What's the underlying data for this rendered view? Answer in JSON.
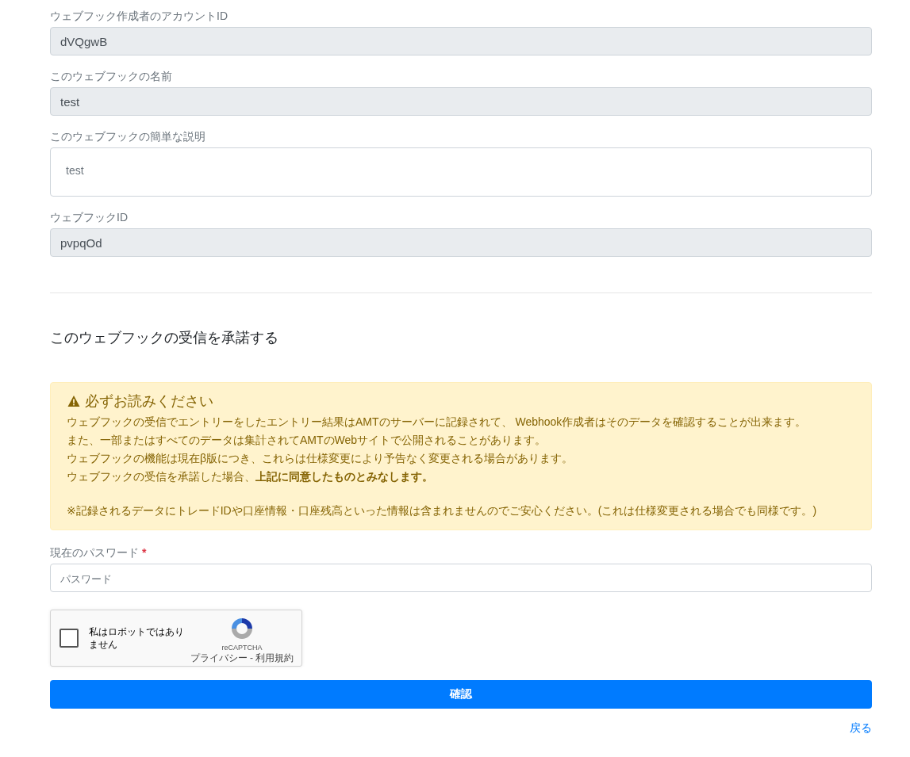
{
  "fields": [
    {
      "label": "ウェブフック作成者のアカウントID",
      "value": "dVQgwB",
      "kind": "input",
      "disabled": true
    },
    {
      "label": "このウェブフックの名前",
      "value": "test",
      "kind": "input",
      "disabled": true
    },
    {
      "label": "このウェブフックの簡単な説明",
      "value": "test",
      "kind": "textarea",
      "disabled": false
    },
    {
      "label": "ウェブフックID",
      "value": "pvpqOd",
      "kind": "input",
      "disabled": true
    }
  ],
  "section_title": "このウェブフックの受信を承諾する",
  "alert": {
    "title": "必ずお読みください",
    "paragraphs": [
      [
        "ウェブフックの受信でエントリーをしたエントリー結果はAMTのサーバーに記録されて、 Webhook作成者はそのデータを確認することが出来ます。",
        "また、一部またはすべてのデータは集計されてAMTのWebサイトで公開されることがあります。",
        "ウェブフックの機能は現在β版につき、これらは仕様変更により予告なく変更される場合があります。",
        "ウェブフックの受信を承諾した場合、**上記に同意したものとみなします。**"
      ],
      [
        "※記録されるデータにトレードIDや口座情報・口座残高といった情報は含まれませんのでご安心ください。(これは仕様変更される場合でも同様です。)"
      ]
    ]
  },
  "password": {
    "label": "現在のパスワード",
    "required": true,
    "required_mark": "*",
    "placeholder": "パスワード"
  },
  "captcha": {
    "label": "私はロボットではありません",
    "checked": false,
    "brand": "reCAPTCHA",
    "links": [
      "プライバシー",
      "利用規約"
    ],
    "separator": "-"
  },
  "submit_button": "確認",
  "back_link": "戻る"
}
